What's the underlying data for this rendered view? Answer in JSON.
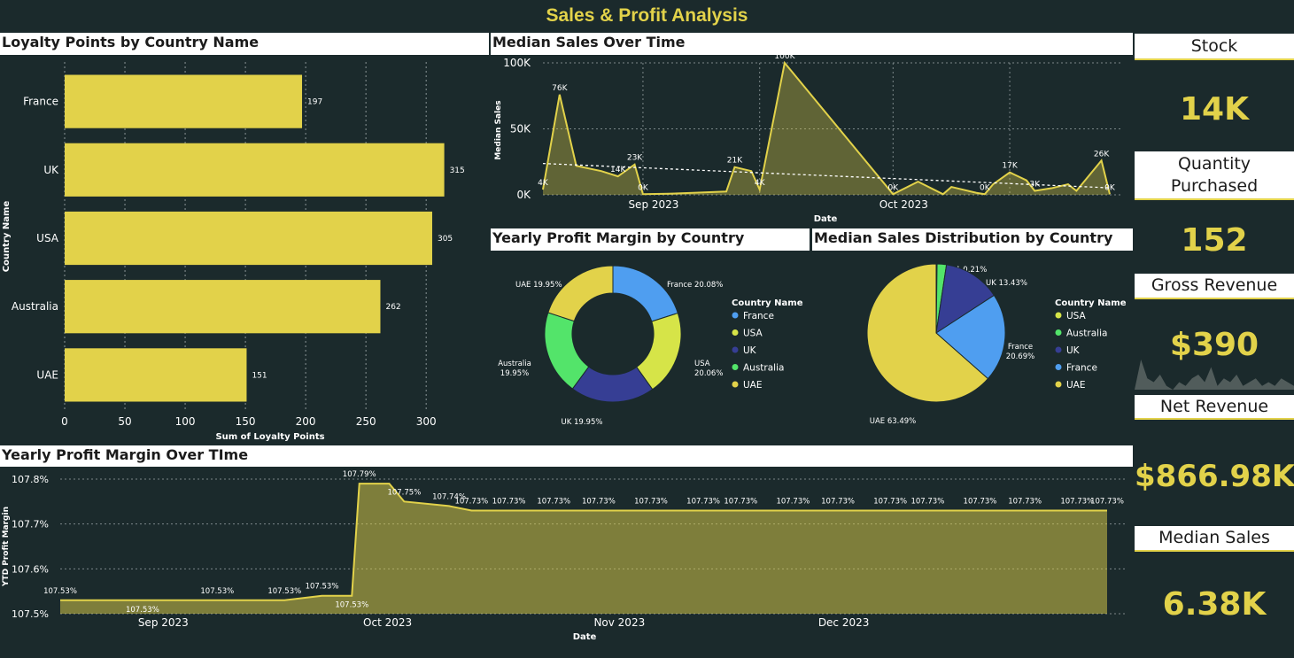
{
  "title": "Sales & Profit Analysis",
  "panels": {
    "loyalty": "Loyalty Points by Country Name",
    "median_sales_time": "Median Sales Over Time",
    "profit_margin_country": "Yearly Profit Margin by Country",
    "sales_distribution": "Median Sales Distribution by Country",
    "profit_margin_time": "Yearly Profit Margin Over TIme"
  },
  "kpis": [
    {
      "label": "Stock",
      "value": "14K"
    },
    {
      "label": "Quantity\nPurchased",
      "value": "152"
    },
    {
      "label": "Gross Revenue",
      "value": "$390"
    },
    {
      "label": "Net Revenue",
      "value": "$866.98K"
    },
    {
      "label": "Median Sales",
      "value": "6.38K"
    }
  ],
  "colors": {
    "background": "#1b2a2c",
    "accent": "#e2d24a",
    "france": "#4f9ef0",
    "usa": "#d6e448",
    "uk": "#363e94",
    "australia": "#53e46a",
    "uae": "#e2d24a"
  },
  "chart_data": [
    {
      "type": "bar",
      "orientation": "horizontal",
      "categories": [
        "France",
        "UK",
        "USA",
        "Australia",
        "UAE"
      ],
      "values": [
        197,
        315,
        305,
        262,
        151
      ],
      "data_labels": [
        "197",
        "315",
        "305",
        "262",
        "151"
      ],
      "xlabel": "Sum of Loyalty Points",
      "ylabel": "Country Name",
      "xticks": [
        "0",
        "50",
        "100",
        "150",
        "200",
        "250",
        "300"
      ],
      "xlim": [
        0,
        330
      ],
      "grid": true
    },
    {
      "type": "area",
      "xlabel": "Date",
      "ylabel": "Median Sales",
      "yticks": [
        "0K",
        "50K",
        "100K"
      ],
      "ylim": [
        0,
        100000
      ],
      "xticks": [
        "Sep 2023",
        "Oct 2023"
      ],
      "trendline": true,
      "points": [
        {
          "date": "2023-08-20",
          "value": 4000,
          "label": "4K"
        },
        {
          "date": "2023-08-22",
          "value": 76000,
          "label": "76K"
        },
        {
          "date": "2023-08-24",
          "value": 22000,
          "label": ""
        },
        {
          "date": "2023-08-27",
          "value": 18000,
          "label": ""
        },
        {
          "date": "2023-08-29",
          "value": 14000,
          "label": "14K"
        },
        {
          "date": "2023-08-31",
          "value": 23000,
          "label": "23K"
        },
        {
          "date": "2023-09-01",
          "value": 500,
          "label": "0K"
        },
        {
          "date": "2023-09-04",
          "value": 800,
          "label": ""
        },
        {
          "date": "2023-09-07",
          "value": 1500,
          "label": ""
        },
        {
          "date": "2023-09-11",
          "value": 2500,
          "label": ""
        },
        {
          "date": "2023-09-12",
          "value": 21000,
          "label": "21K"
        },
        {
          "date": "2023-09-14",
          "value": 18000,
          "label": ""
        },
        {
          "date": "2023-09-15",
          "value": 4000,
          "label": "4K"
        },
        {
          "date": "2023-09-18",
          "value": 100000,
          "label": "100K"
        },
        {
          "date": "2023-10-01",
          "value": 500,
          "label": "0K"
        },
        {
          "date": "2023-10-04",
          "value": 10000,
          "label": ""
        },
        {
          "date": "2023-10-07",
          "value": 500,
          "label": ""
        },
        {
          "date": "2023-10-08",
          "value": 6000,
          "label": ""
        },
        {
          "date": "2023-10-11",
          "value": 1500,
          "label": ""
        },
        {
          "date": "2023-10-12",
          "value": 500,
          "label": "0K"
        },
        {
          "date": "2023-10-13",
          "value": 8000,
          "label": ""
        },
        {
          "date": "2023-10-15",
          "value": 17000,
          "label": "17K"
        },
        {
          "date": "2023-10-17",
          "value": 11000,
          "label": ""
        },
        {
          "date": "2023-10-18",
          "value": 3000,
          "label": "3K"
        },
        {
          "date": "2023-10-20",
          "value": 5000,
          "label": ""
        },
        {
          "date": "2023-10-22",
          "value": 8000,
          "label": ""
        },
        {
          "date": "2023-10-23",
          "value": 3000,
          "label": ""
        },
        {
          "date": "2023-10-26",
          "value": 26000,
          "label": "26K"
        },
        {
          "date": "2023-10-27",
          "value": 500,
          "label": "0K"
        }
      ]
    },
    {
      "type": "pie",
      "variant": "donut",
      "legend_title": "Country Name",
      "legend": [
        "France",
        "USA",
        "UK",
        "Australia",
        "UAE"
      ],
      "slices": [
        {
          "name": "France",
          "value": 20.08,
          "label": "France 20.08%"
        },
        {
          "name": "USA",
          "value": 20.06,
          "label": "USA\n20.06%"
        },
        {
          "name": "UK",
          "value": 19.95,
          "label": "UK 19.95%"
        },
        {
          "name": "Australia",
          "value": 19.95,
          "label": "Australia\n19.95%"
        },
        {
          "name": "UAE",
          "value": 19.95,
          "label": "UAE 19.95%"
        }
      ]
    },
    {
      "type": "pie",
      "legend_title": "Country Name",
      "legend": [
        "USA",
        "Australia",
        "UK",
        "France",
        "UAE"
      ],
      "slices": [
        {
          "name": "USA",
          "value": 0.21,
          "label": "USA 0.21%"
        },
        {
          "name": "Australia",
          "value": 2.18,
          "label": ""
        },
        {
          "name": "UK",
          "value": 13.43,
          "label": "UK 13.43%"
        },
        {
          "name": "France",
          "value": 20.69,
          "label": "France\n20.69%"
        },
        {
          "name": "UAE",
          "value": 63.49,
          "label": "UAE 63.49%"
        }
      ]
    },
    {
      "type": "area",
      "xlabel": "Date",
      "ylabel": "YTD Profit Margin",
      "yticks": [
        "107.5%",
        "107.6%",
        "107.7%",
        "107.8%"
      ],
      "ylim": [
        107.5,
        107.8
      ],
      "xticks": [
        "Sep 2023",
        "Oct 2023",
        "Nov 2023",
        "Dec 2023"
      ],
      "points": [
        {
          "date": "2023-08-20",
          "value": 107.53,
          "label": "107.53%"
        },
        {
          "date": "2023-08-31",
          "value": 107.53,
          "label": "107.53%"
        },
        {
          "date": "2023-09-10",
          "value": 107.53,
          "label": "107.53%"
        },
        {
          "date": "2023-09-19",
          "value": 107.53,
          "label": "107.53%"
        },
        {
          "date": "2023-09-24",
          "value": 107.54,
          "label": "107.53%"
        },
        {
          "date": "2023-09-28",
          "value": 107.54,
          "label": "107.53%"
        },
        {
          "date": "2023-09-29",
          "value": 107.79,
          "label": "107.79%"
        },
        {
          "date": "2023-10-03",
          "value": 107.79,
          "label": ""
        },
        {
          "date": "2023-10-05",
          "value": 107.75,
          "label": "107.75%"
        },
        {
          "date": "2023-10-11",
          "value": 107.74,
          "label": "107.74%"
        },
        {
          "date": "2023-10-14",
          "value": 107.73,
          "label": "107.73%"
        },
        {
          "date": "2023-10-19",
          "value": 107.73,
          "label": "107.73%"
        },
        {
          "date": "2023-10-25",
          "value": 107.73,
          "label": "107.73%"
        },
        {
          "date": "2023-10-31",
          "value": 107.73,
          "label": "107.73%"
        },
        {
          "date": "2023-11-07",
          "value": 107.73,
          "label": "107.73%"
        },
        {
          "date": "2023-11-14",
          "value": 107.73,
          "label": "107.73%"
        },
        {
          "date": "2023-11-19",
          "value": 107.73,
          "label": "107.73%"
        },
        {
          "date": "2023-11-26",
          "value": 107.73,
          "label": "107.73%"
        },
        {
          "date": "2023-12-02",
          "value": 107.73,
          "label": "107.73%"
        },
        {
          "date": "2023-12-09",
          "value": 107.73,
          "label": "107.73%"
        },
        {
          "date": "2023-12-14",
          "value": 107.73,
          "label": "107.73%"
        },
        {
          "date": "2023-12-21",
          "value": 107.73,
          "label": "107.73%"
        },
        {
          "date": "2023-12-27",
          "value": 107.73,
          "label": "107.73%"
        },
        {
          "date": "2024-01-03",
          "value": 107.73,
          "label": "107.73%"
        },
        {
          "date": "2024-01-07",
          "value": 107.73,
          "label": "107.73%"
        }
      ]
    }
  ],
  "gross_revenue_sparkline": [
    0,
    8,
    3,
    2,
    4,
    1,
    0,
    2,
    1,
    3,
    4,
    2,
    6,
    1,
    3,
    2,
    4,
    1,
    2,
    3,
    1,
    2,
    1,
    3,
    2,
    1
  ]
}
